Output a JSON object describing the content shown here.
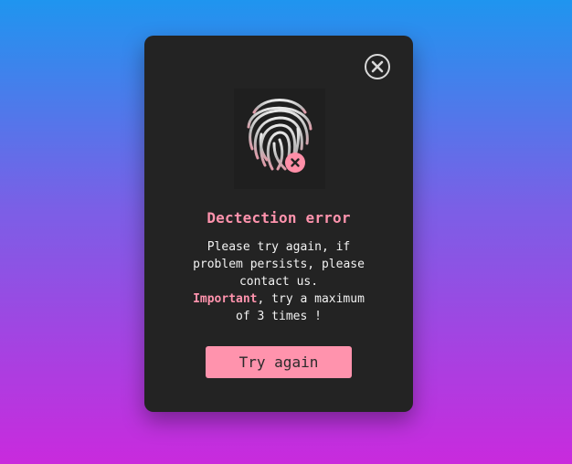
{
  "dialog": {
    "title": "Dectection error",
    "message_line1": "Please try again, if problem persists, please contact us.",
    "important_label": "Important",
    "message_line2": ", try a maximum of 3 times !",
    "button_label": "Try again",
    "icons": {
      "close": "close-circle-icon",
      "main": "fingerprint-icon",
      "badge": "error-x-icon"
    },
    "colors": {
      "accent": "#ff93ad",
      "panel": "#232323",
      "text": "#f2f2f2",
      "gradient_top": "#1f95ef",
      "gradient_bottom": "#c92add"
    }
  }
}
